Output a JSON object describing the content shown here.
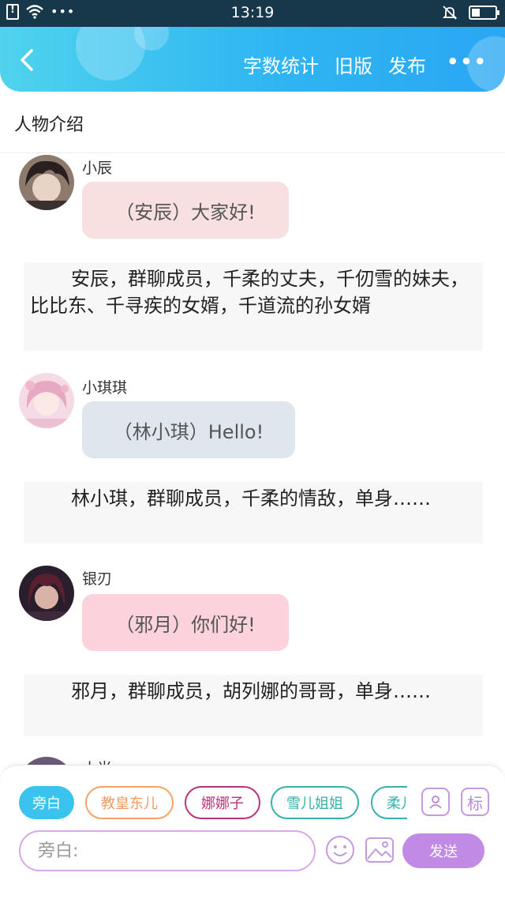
{
  "status_bar": {
    "time": "13:19",
    "dots": "•••"
  },
  "header": {
    "actions": [
      "字数统计",
      "旧版",
      "发布"
    ],
    "more": "•••"
  },
  "section": {
    "title": "人物介绍"
  },
  "messages": [
    {
      "sender": "小辰",
      "text": "（安辰）大家好!",
      "bubble_color": "#f8e0e0",
      "narration": "安辰，群聊成员，千柔的丈夫，千仞雪的妹夫，比比东、千寻疾的女婿，千道流的孙女婿"
    },
    {
      "sender": "小琪琪",
      "text": "（林小琪）Hello!",
      "bubble_color": "#dfe6ee",
      "narration": "林小琪，群聊成员，千柔的情敌，单身……"
    },
    {
      "sender": "银刃",
      "text": "（邪月）你们好!",
      "bubble_color": "#fcd3dc",
      "narration": "邪月，群聊成员，胡列娜的哥哥，单身……"
    },
    {
      "sender": "小光"
    }
  ],
  "composer": {
    "chips": [
      {
        "label": "旁白",
        "color": "#39c3ee",
        "filled": true
      },
      {
        "label": "教皇东儿",
        "color": "#f3a26e",
        "filled": false
      },
      {
        "label": "娜娜子",
        "color": "#b8347a",
        "filled": false
      },
      {
        "label": "雪儿姐姐",
        "color": "#39b0a8",
        "filled": false
      },
      {
        "label": "柔儿",
        "color": "#39b0a8",
        "filled": false
      }
    ],
    "tag_icon_label": "标",
    "input_placeholder": "旁白:",
    "send_label": "发送",
    "accent": "#c18ae5"
  }
}
